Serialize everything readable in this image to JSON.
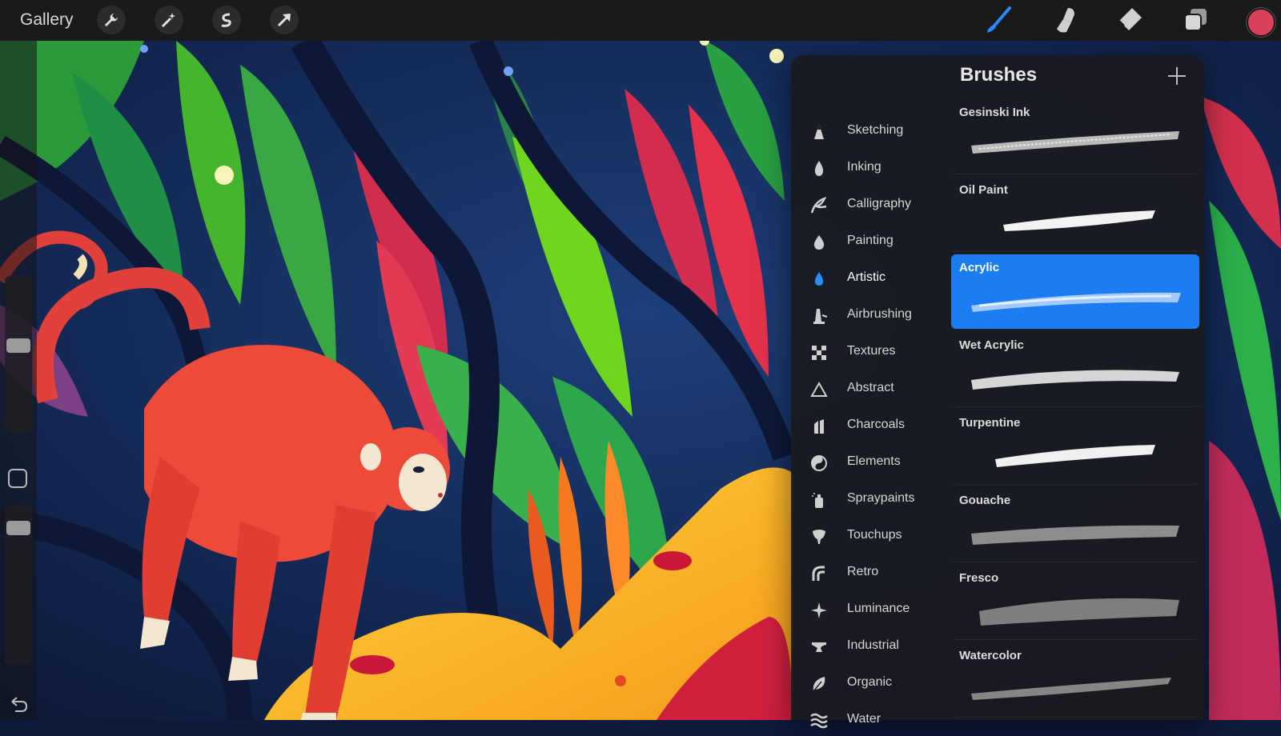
{
  "topbar": {
    "gallery_label": "Gallery",
    "left_tools": [
      "wrench-icon",
      "magic-wand-icon",
      "selection-icon",
      "transform-arrow-icon"
    ],
    "right_tools": [
      "brush-icon",
      "smudge-icon",
      "eraser-icon",
      "layers-icon"
    ],
    "current_color": "#d9415a"
  },
  "panel": {
    "title": "Brushes",
    "add_icon": "plus-icon",
    "categories": [
      {
        "label": "Sketching",
        "icon": "sketching-icon"
      },
      {
        "label": "Inking",
        "icon": "ink-drop-icon"
      },
      {
        "label": "Calligraphy",
        "icon": "calligraphy-icon"
      },
      {
        "label": "Painting",
        "icon": "paint-drop-icon"
      },
      {
        "label": "Artistic",
        "icon": "artistic-drop-icon",
        "selected": true
      },
      {
        "label": "Airbrushing",
        "icon": "airbrush-icon"
      },
      {
        "label": "Textures",
        "icon": "textures-icon"
      },
      {
        "label": "Abstract",
        "icon": "abstract-triangle-icon"
      },
      {
        "label": "Charcoals",
        "icon": "charcoal-icon"
      },
      {
        "label": "Elements",
        "icon": "yin-yang-icon"
      },
      {
        "label": "Spraypaints",
        "icon": "spraycan-icon"
      },
      {
        "label": "Touchups",
        "icon": "touchup-icon"
      },
      {
        "label": "Retro",
        "icon": "retro-icon"
      },
      {
        "label": "Luminance",
        "icon": "sparkle-icon"
      },
      {
        "label": "Industrial",
        "icon": "anvil-icon"
      },
      {
        "label": "Organic",
        "icon": "leaf-icon"
      },
      {
        "label": "Water",
        "icon": "waves-icon"
      }
    ],
    "brushes": [
      {
        "name": "Gesinski Ink"
      },
      {
        "name": "Oil Paint"
      },
      {
        "name": "Acrylic",
        "selected": true
      },
      {
        "name": "Wet Acrylic"
      },
      {
        "name": "Turpentine"
      },
      {
        "name": "Gouache"
      },
      {
        "name": "Fresco"
      },
      {
        "name": "Watercolor"
      }
    ],
    "accent_color": "#1c7cf2"
  },
  "sidebar": {
    "size_slider": 0.55,
    "opacity_slider": 0.85,
    "modify_button": "square-icon",
    "undo_icon": "undo-icon"
  }
}
